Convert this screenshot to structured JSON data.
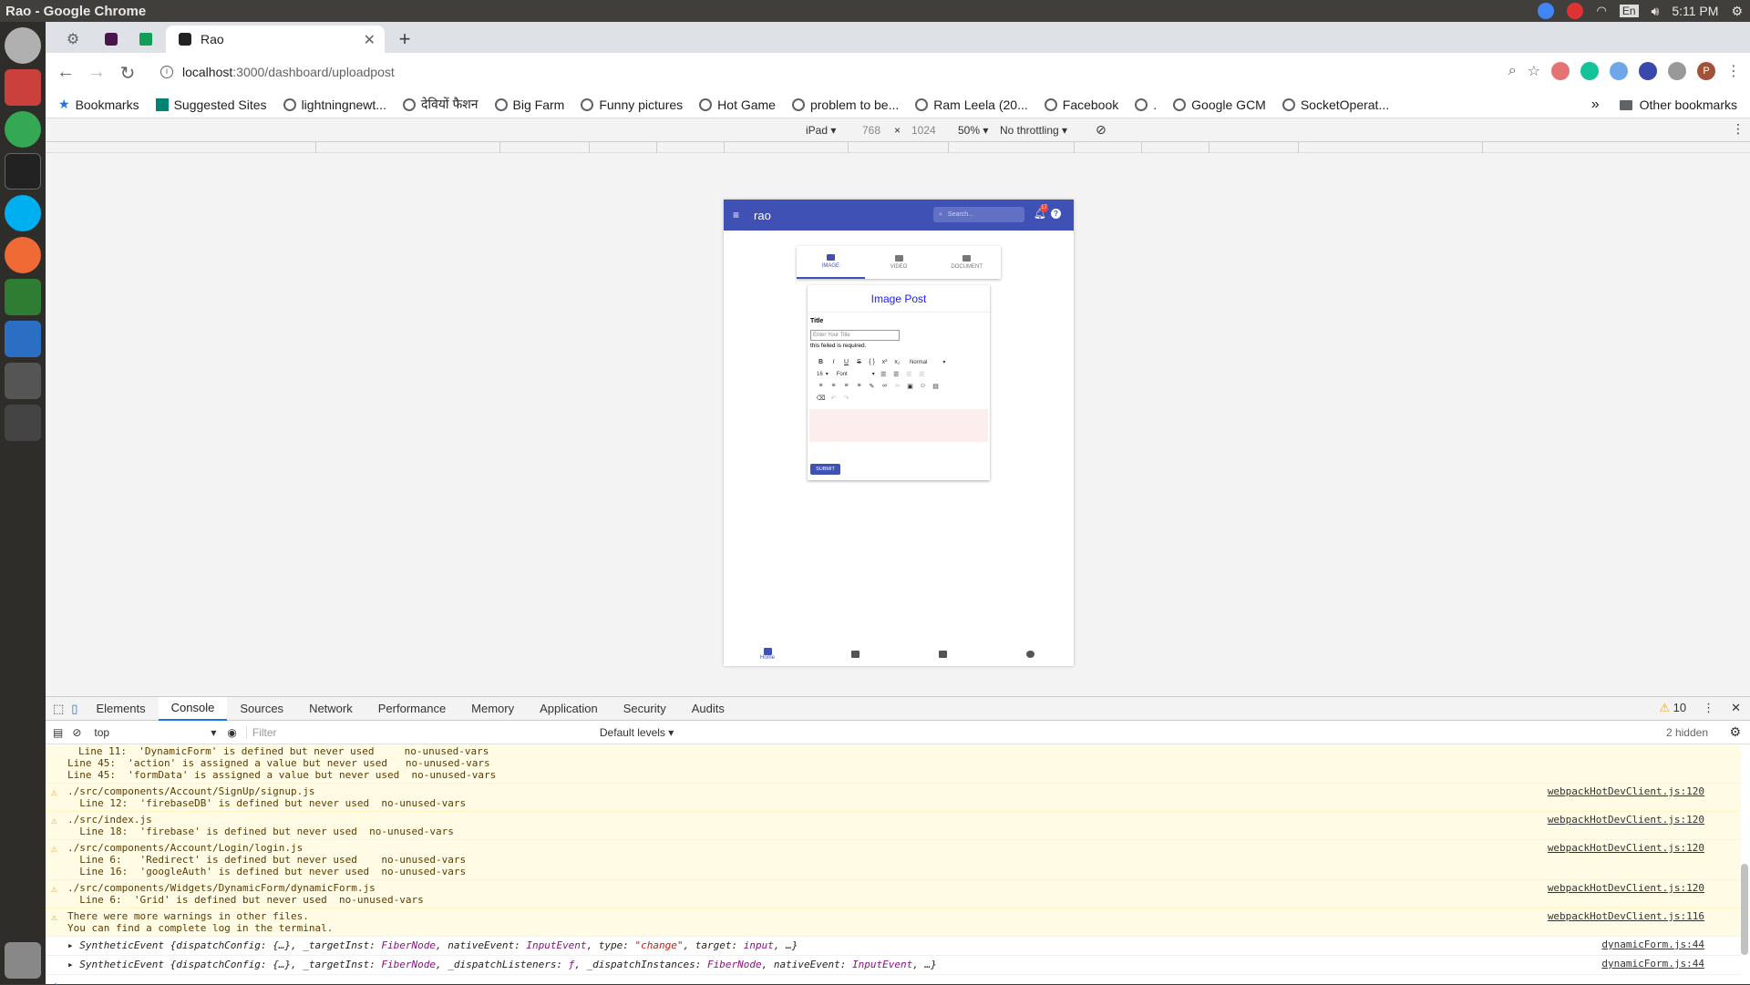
{
  "os": {
    "window_title": "Rao - Google Chrome",
    "time": "5:11 PM",
    "lang": "En"
  },
  "browser": {
    "tab_title": "Rao",
    "url_host": "localhost",
    "url_path": ":3000/dashboard/uploadpost",
    "bookmarks": [
      "Bookmarks",
      "Suggested Sites",
      "lightningnewt...",
      "देवियों फैशन",
      "Big Farm",
      "Funny pictures",
      "Hot Game",
      "problem to be...",
      "Ram Leela (20...",
      "Facebook",
      ".",
      "Google GCM",
      "SocketOperat..."
    ],
    "overflow": "»",
    "other_bookmarks": "Other bookmarks",
    "profile_initial": "P"
  },
  "device_toolbar": {
    "device": "iPad",
    "width": "768",
    "x": "×",
    "height": "1024",
    "zoom": "50%",
    "throttle": "No throttling"
  },
  "app": {
    "brand": "rao",
    "search_placeholder": "Search...",
    "badge_count": "17",
    "tabs": [
      "IMAGE",
      "VIDEO",
      "DOCUMENT"
    ],
    "card_title": "Image Post",
    "title_label": "Title",
    "title_placeholder": "Enter Your Title",
    "required_msg": "this feiled is required.",
    "toolbar": {
      "bold": "B",
      "italic": "I",
      "underline": "U",
      "strike": "S",
      "code": "{ }",
      "sup": "x²",
      "sub": "x₂",
      "block_type": "Normal",
      "font_size": "16",
      "font_family": "Font"
    },
    "submit": "SUBMIT",
    "bottom_nav": [
      "Home",
      "",
      "",
      ""
    ]
  },
  "devtools": {
    "tabs": [
      "Elements",
      "Console",
      "Sources",
      "Network",
      "Performance",
      "Memory",
      "Application",
      "Security",
      "Audits"
    ],
    "active_tab": "Console",
    "warn_count": "10",
    "context": "top",
    "filter_placeholder": "Filter",
    "levels": "Default levels",
    "hidden": "2 hidden",
    "messages": [
      {
        "body": "Line 11:  'DynamicForm' is defined but never used     no-unused-vars\nLine 45:  'action' is assigned a value but never used   no-unused-vars\nLine 45:  'formData' is assigned a value but never used  no-unused-vars",
        "src": "",
        "warn": false
      },
      {
        "body": "./src/components/Account/SignUp/signup.js\n  Line 12:  'firebaseDB' is defined but never used  no-unused-vars",
        "src": "webpackHotDevClient.js:120",
        "warn": true
      },
      {
        "body": "./src/index.js\n  Line 18:  'firebase' is defined but never used  no-unused-vars",
        "src": "webpackHotDevClient.js:120",
        "warn": true
      },
      {
        "body": "./src/components/Account/Login/login.js\n  Line 6:   'Redirect' is defined but never used    no-unused-vars\n  Line 16:  'googleAuth' is defined but never used  no-unused-vars",
        "src": "webpackHotDevClient.js:120",
        "warn": true
      },
      {
        "body": "./src/components/Widgets/DynamicForm/dynamicForm.js\n  Line 6:  'Grid' is defined but never used  no-unused-vars",
        "src": "webpackHotDevClient.js:120",
        "warn": true
      },
      {
        "body": "There were more warnings in other files.\nYou can find a complete log in the terminal.",
        "src": "webpackHotDevClient.js:116",
        "warn": true
      }
    ],
    "logs": [
      {
        "src": "dynamicForm.js:44"
      },
      {
        "src": "dynamicForm.js:44"
      }
    ],
    "prompt": "›"
  }
}
